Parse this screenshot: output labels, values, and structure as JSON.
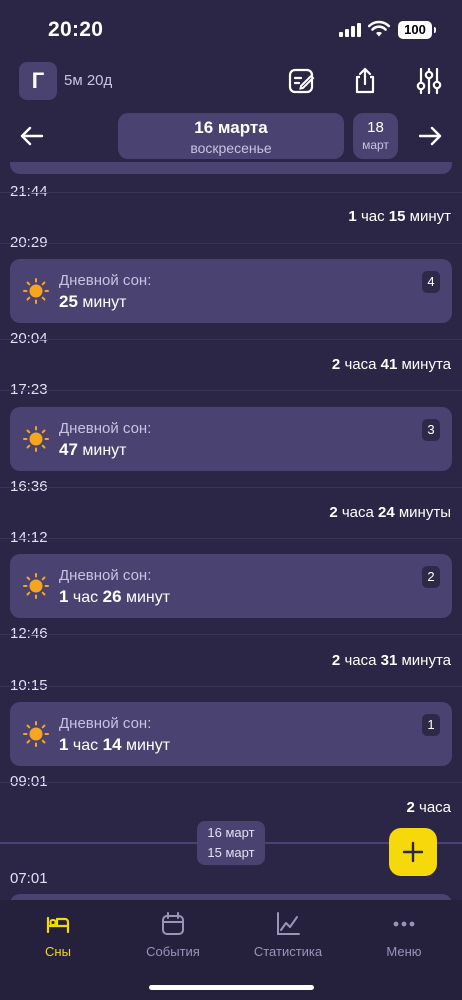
{
  "status_bar": {
    "time": "20:20",
    "battery": "100"
  },
  "header": {
    "avatar_letter": "Г",
    "age": "5м 20д"
  },
  "date_nav": {
    "current_day": "16 марта",
    "current_weekday": "воскресенье",
    "next_day_num": "18",
    "next_day_month": "март"
  },
  "timeline": {
    "times": [
      "21:44",
      "20:29",
      "20:04",
      "17:23",
      "16:36",
      "14:12",
      "12:46",
      "10:15",
      "09:01",
      "07:01"
    ],
    "gaps": [
      {
        "n1": "1",
        "u1": "час",
        "n2": "15",
        "u2": "минут"
      },
      {
        "n1": "2",
        "u1": "часа",
        "n2": "41",
        "u2": "минута"
      },
      {
        "n1": "2",
        "u1": "часа",
        "n2": "24",
        "u2": "минуты"
      },
      {
        "n1": "2",
        "u1": "часа",
        "n2": "31",
        "u2": "минута"
      },
      {
        "n1": "2",
        "u1": "часа",
        "n2": "",
        "u2": ""
      }
    ],
    "naps": [
      {
        "label": "Дневной сон:",
        "h": "",
        "hu": "",
        "m": "25",
        "mu": "минут",
        "badge": "4"
      },
      {
        "label": "Дневной сон:",
        "h": "",
        "hu": "",
        "m": "47",
        "mu": "минут",
        "badge": "3"
      },
      {
        "label": "Дневной сон:",
        "h": "1",
        "hu": "час",
        "m": "26",
        "mu": "минут",
        "badge": "2"
      },
      {
        "label": "Дневной сон:",
        "h": "1",
        "hu": "час",
        "m": "14",
        "mu": "минут",
        "badge": "1"
      }
    ],
    "divider": {
      "upper": "16 март",
      "lower": "15 март"
    }
  },
  "bottom_nav": {
    "items": [
      "Сны",
      "События",
      "Статистика",
      "Меню"
    ],
    "active": "Сны"
  },
  "colors": {
    "background": "#2b2646",
    "card": "#4a4270",
    "accent": "#f5d90a",
    "nav_bg": "#25213d"
  }
}
